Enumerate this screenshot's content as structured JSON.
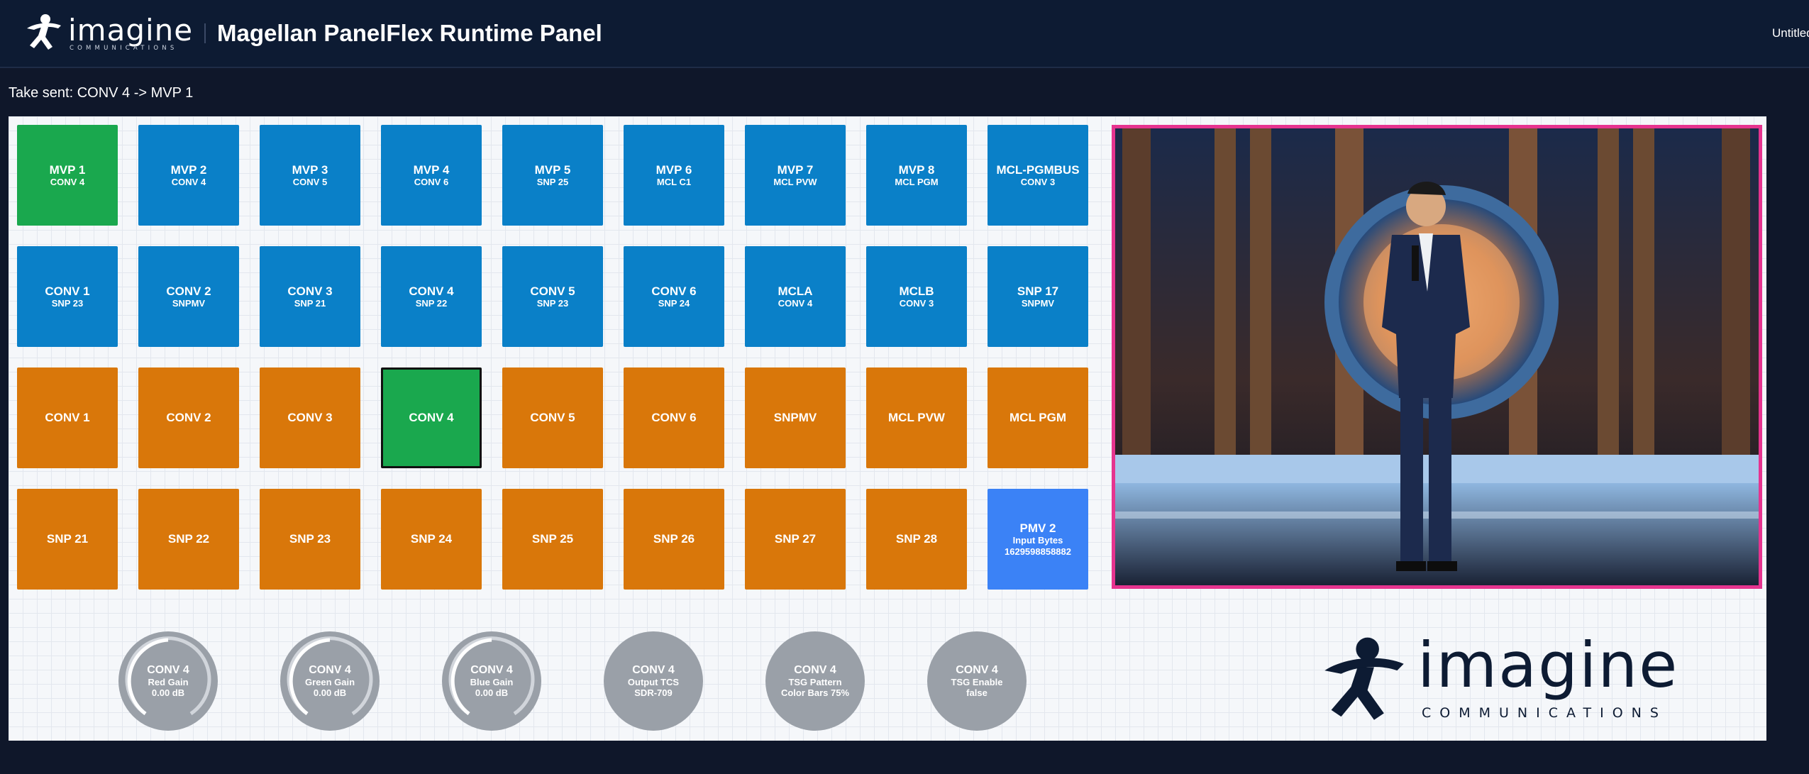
{
  "header": {
    "logo_word": "imagine",
    "logo_sub": "COMMUNICATIONS",
    "title": "Magellan PanelFlex Runtime Panel",
    "doc_name": "Untitled"
  },
  "status": "Take sent: CONV 4 -> MVP 1",
  "colors": {
    "blue": "#0a80c8",
    "orange": "#d9770a",
    "green": "#1aa84e",
    "lightblue": "#3b82f6",
    "preview_border": "#e6348f",
    "knob": "#9aa0a8"
  },
  "rows": [
    [
      {
        "l1": "MVP 1",
        "l2": "CONV 4"
      },
      {
        "l1": "MVP 2",
        "l2": "CONV 4"
      },
      {
        "l1": "MVP 3",
        "l2": "CONV 5"
      },
      {
        "l1": "MVP 4",
        "l2": "CONV 6"
      },
      {
        "l1": "MVP 5",
        "l2": "SNP 25"
      },
      {
        "l1": "MVP 6",
        "l2": "MCL C1"
      },
      {
        "l1": "MVP 7",
        "l2": "MCL PVW"
      },
      {
        "l1": "MVP 8",
        "l2": "MCL PGM"
      },
      {
        "l1": "MCL-PGMBUS",
        "l2": "CONV 3"
      }
    ],
    [
      {
        "l1": "CONV 1",
        "l2": "SNP 23"
      },
      {
        "l1": "CONV 2",
        "l2": "SNPMV"
      },
      {
        "l1": "CONV 3",
        "l2": "SNP 21"
      },
      {
        "l1": "CONV 4",
        "l2": "SNP 22"
      },
      {
        "l1": "CONV 5",
        "l2": "SNP 23"
      },
      {
        "l1": "CONV 6",
        "l2": "SNP 24"
      },
      {
        "l1": "MCLA",
        "l2": "CONV 4"
      },
      {
        "l1": "MCLB",
        "l2": "CONV 3"
      },
      {
        "l1": "SNP 17",
        "l2": "SNPMV"
      }
    ],
    [
      "CONV 1",
      "CONV 2",
      "CONV 3",
      "CONV 4",
      "CONV 5",
      "CONV 6",
      "SNPMV",
      "MCL PVW",
      "MCL PGM"
    ],
    [
      "SNP 21",
      "SNP 22",
      "SNP 23",
      "SNP 24",
      "SNP 25",
      "SNP 26",
      "SNP 27",
      "SNP 28"
    ]
  ],
  "pmv": {
    "l1": "PMV 2",
    "l2": "Input Bytes",
    "l3": "1629598858882"
  },
  "knobs": [
    {
      "l1": "CONV 4",
      "l2": "Red Gain",
      "l3": "0.00 dB"
    },
    {
      "l1": "CONV 4",
      "l2": "Green Gain",
      "l3": "0.00 dB"
    },
    {
      "l1": "CONV 4",
      "l2": "Blue Gain",
      "l3": "0.00 dB"
    },
    {
      "l1": "CONV 4",
      "l2": "Output TCS",
      "l3": "SDR-709"
    },
    {
      "l1": "CONV 4",
      "l2": "TSG Pattern",
      "l3": "Color Bars 75%"
    },
    {
      "l1": "CONV 4",
      "l2": "TSG Enable",
      "l3": "false"
    }
  ],
  "brand": {
    "word": "imagine",
    "sub": "COMMUNICATIONS"
  }
}
